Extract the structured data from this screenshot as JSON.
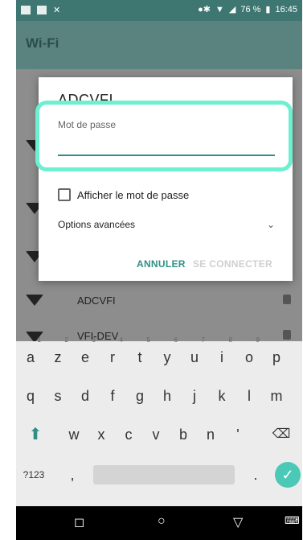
{
  "status_bar": {
    "battery_percent": "76 %",
    "time": "16:45",
    "icons": [
      "image-icon",
      "message-icon",
      "close-icon",
      "bluetooth-icon",
      "wifi-icon",
      "signal-icon",
      "battery-icon"
    ]
  },
  "app_bar": {
    "title": "Wi-Fi"
  },
  "background_list": {
    "items": [
      {
        "label": ""
      },
      {
        "label": ""
      },
      {
        "label": ""
      },
      {
        "label": ""
      },
      {
        "label": "ADCVFI"
      },
      {
        "label": "VFI-DEV"
      }
    ]
  },
  "dialog": {
    "title": "ADCVFI",
    "password_label": "Mot de passe",
    "password_value": "",
    "show_password_label": "Afficher le mot de passe",
    "show_password_checked": false,
    "advanced_options_label": "Options avancées",
    "cancel_label": "ANNULER",
    "connect_label": "SE CONNECTER"
  },
  "keyboard": {
    "row1": [
      {
        "key": "a",
        "num": "1"
      },
      {
        "key": "z",
        "num": "2"
      },
      {
        "key": "e",
        "num": "3"
      },
      {
        "key": "r",
        "num": "4"
      },
      {
        "key": "t",
        "num": "5"
      },
      {
        "key": "y",
        "num": "6"
      },
      {
        "key": "u",
        "num": "7"
      },
      {
        "key": "i",
        "num": "8"
      },
      {
        "key": "o",
        "num": "9"
      },
      {
        "key": "p",
        "num": ""
      }
    ],
    "row2": [
      "q",
      "s",
      "d",
      "f",
      "g",
      "h",
      "j",
      "k",
      "l",
      "m"
    ],
    "row3": [
      "w",
      "x",
      "c",
      "v",
      "b",
      "n",
      "'"
    ],
    "symbols_label": "?123",
    "comma_label": ",",
    "period_label": "."
  },
  "colors": {
    "accent": "#2f8f87",
    "highlight": "#6df0cf",
    "enter": "#4bc8b6"
  }
}
